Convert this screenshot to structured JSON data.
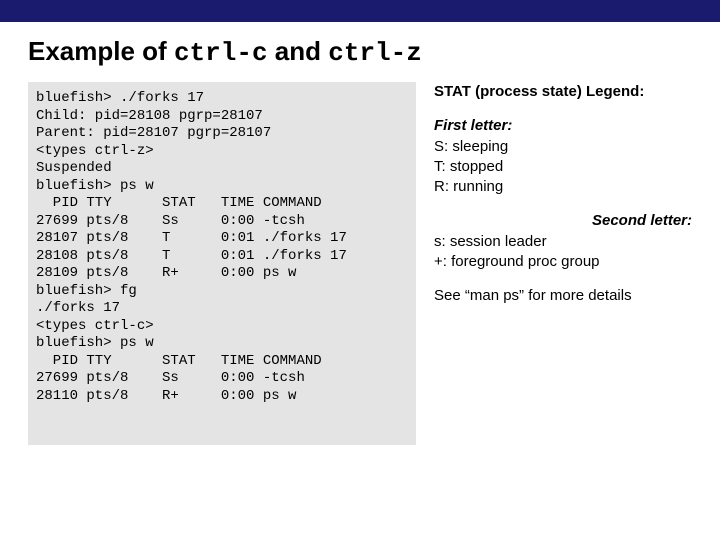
{
  "title": {
    "pre": "Example of ",
    "c1": "ctrl-c",
    "mid": " and ",
    "c2": "ctrl-z"
  },
  "terminal": "bluefish> ./forks 17\nChild: pid=28108 pgrp=28107\nParent: pid=28107 pgrp=28107\n<types ctrl-z>\nSuspended\nbluefish> ps w\n  PID TTY      STAT   TIME COMMAND\n27699 pts/8    Ss     0:00 -tcsh\n28107 pts/8    T      0:01 ./forks 17\n28108 pts/8    T      0:01 ./forks 17\n28109 pts/8    R+     0:00 ps w\nbluefish> fg\n./forks 17\n<types ctrl-c>\nbluefish> ps w\n  PID TTY      STAT   TIME COMMAND\n27699 pts/8    Ss     0:00 -tcsh\n28110 pts/8    R+     0:00 ps w",
  "legend": {
    "header": "STAT (process state) Legend:",
    "first_label": "First letter:",
    "s": "S: sleeping",
    "t": "T: stopped",
    "r": "R: running",
    "second_label": "Second letter:",
    "sl": "s: session leader",
    "fg": "+: foreground proc group",
    "more": "See “man ps” for more details"
  }
}
